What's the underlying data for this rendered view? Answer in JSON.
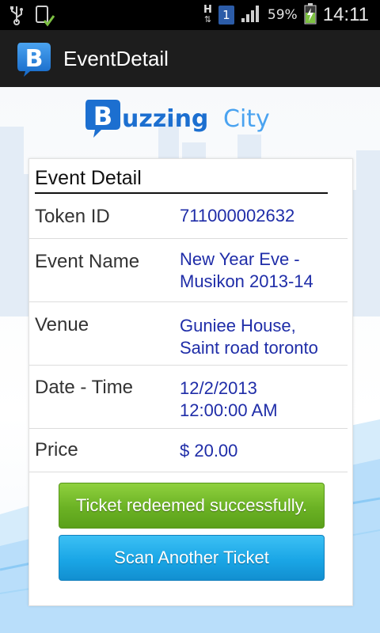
{
  "status_bar": {
    "battery_percent": "59%",
    "time": "14:11",
    "network_type": "H",
    "sim_badge": "1",
    "icons": [
      "usb-icon",
      "download-done-icon",
      "data-arrows-icon",
      "sim-icon",
      "signal-icon",
      "battery-charging-icon"
    ]
  },
  "action_bar": {
    "title": "EventDetail",
    "app_icon": "buzzingcity-b-icon"
  },
  "logo": {
    "text": "BuzzingCity"
  },
  "card": {
    "title": "Event Detail",
    "rows": [
      {
        "label": "Token ID",
        "value": "711000002632"
      },
      {
        "label": "Event Name",
        "value_lines": [
          "New Year Eve -",
          "Musikon 2013-14"
        ]
      },
      {
        "label": "Venue",
        "value_lines": [
          "Guniee House,",
          "Saint road toronto"
        ]
      },
      {
        "label": "Date - Time",
        "value_lines": [
          "12/2/2013",
          "12:00:00 AM"
        ]
      },
      {
        "label": "Price",
        "value": "$ 20.00"
      }
    ],
    "status_button_label": "Ticket redeemed successfully.",
    "scan_button_label": "Scan Another Ticket"
  },
  "colors": {
    "value_text": "#1f2da8",
    "success_button": "#6bb224",
    "scan_button": "#1aa6e6",
    "logo_blue": "#1c6fd0"
  }
}
